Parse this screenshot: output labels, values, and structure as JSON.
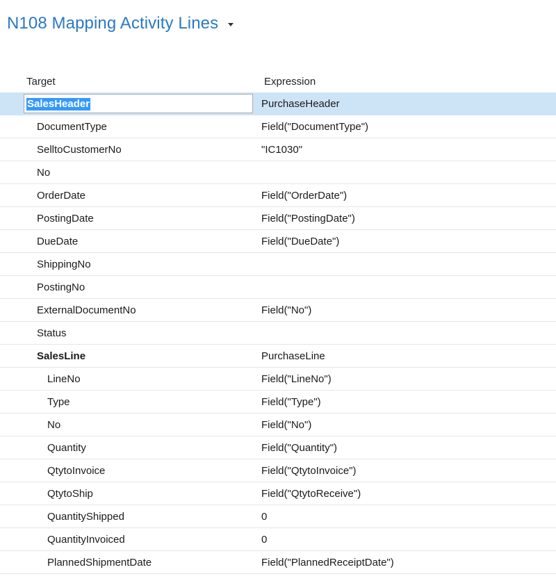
{
  "page": {
    "title": "N108 Mapping Activity Lines"
  },
  "columns": {
    "target": "Target",
    "expression": "Expression"
  },
  "rows": [
    {
      "target": "SalesHeader",
      "expression": "PurchaseHeader",
      "level": 0,
      "bold": true,
      "selected": true
    },
    {
      "target": "DocumentType",
      "expression": "Field(\"DocumentType\")",
      "level": 1
    },
    {
      "target": "SelltoCustomerNo",
      "expression": "\"IC1030\"",
      "level": 1
    },
    {
      "target": "No",
      "expression": "",
      "level": 1
    },
    {
      "target": "OrderDate",
      "expression": "Field(\"OrderDate\")",
      "level": 1
    },
    {
      "target": "PostingDate",
      "expression": "Field(\"PostingDate\")",
      "level": 1
    },
    {
      "target": "DueDate",
      "expression": "Field(\"DueDate\")",
      "level": 1
    },
    {
      "target": "ShippingNo",
      "expression": "",
      "level": 1
    },
    {
      "target": "PostingNo",
      "expression": "",
      "level": 1
    },
    {
      "target": "ExternalDocumentNo",
      "expression": "Field(\"No\")",
      "level": 1
    },
    {
      "target": "Status",
      "expression": "",
      "level": 1
    },
    {
      "target": "SalesLine",
      "expression": "PurchaseLine",
      "level": 1,
      "bold": true
    },
    {
      "target": "LineNo",
      "expression": "Field(\"LineNo\")",
      "level": 2
    },
    {
      "target": "Type",
      "expression": "Field(\"Type\")",
      "level": 2
    },
    {
      "target": "No",
      "expression": "Field(\"No\")",
      "level": 2
    },
    {
      "target": "Quantity",
      "expression": "Field(\"Quantity\")",
      "level": 2
    },
    {
      "target": "QtytoInvoice",
      "expression": "Field(\"QtytoInvoice\")",
      "level": 2
    },
    {
      "target": "QtytoShip",
      "expression": "Field(\"QtytoReceive\")",
      "level": 2
    },
    {
      "target": "QuantityShipped",
      "expression": "0",
      "level": 2
    },
    {
      "target": "QuantityInvoiced",
      "expression": "0",
      "level": 2
    },
    {
      "target": "PlannedShipmentDate",
      "expression": "Field(\"PlannedReceiptDate\")",
      "level": 2
    }
  ]
}
